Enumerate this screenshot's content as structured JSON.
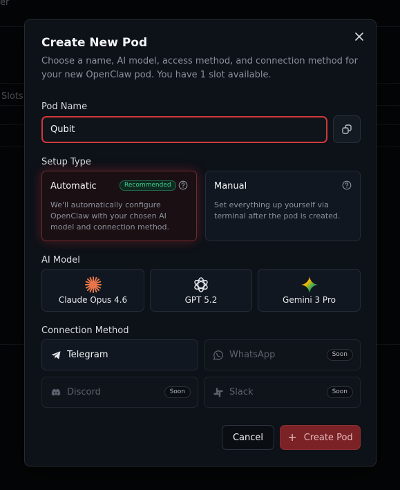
{
  "background": {
    "fragment_top": "er",
    "fragment_slots": "Slots"
  },
  "modal": {
    "title": "Create New Pod",
    "description": "Choose a name, AI model, access method, and connection method for your new OpenClaw pod. You have 1 slot available.",
    "close_icon": "close-icon"
  },
  "pod_name": {
    "label": "Pod Name",
    "value": "Qubit",
    "link_icon": "link-icon"
  },
  "setup_type": {
    "label": "Setup Type",
    "options": [
      {
        "title": "Automatic",
        "badge": "Recommended",
        "description": "We'll automatically configure OpenClaw with your chosen AI model and connection method.",
        "selected": true
      },
      {
        "title": "Manual",
        "description": "Set everything up yourself via terminal after the pod is created.",
        "selected": false
      }
    ]
  },
  "ai_model": {
    "label": "AI Model",
    "options": [
      {
        "name": "Claude Opus 4.6",
        "icon": "claude-icon"
      },
      {
        "name": "GPT 5.2",
        "icon": "openai-icon"
      },
      {
        "name": "Gemini 3 Pro",
        "icon": "gemini-icon"
      }
    ]
  },
  "connection_method": {
    "label": "Connection Method",
    "options": [
      {
        "name": "Telegram",
        "icon": "telegram-icon",
        "badge": ""
      },
      {
        "name": "WhatsApp",
        "icon": "whatsapp-icon",
        "badge": "Soon"
      },
      {
        "name": "Discord",
        "icon": "discord-icon",
        "badge": "Soon"
      },
      {
        "name": "Slack",
        "icon": "slack-icon",
        "badge": "Soon"
      }
    ]
  },
  "actions": {
    "cancel_label": "Cancel",
    "create_label": "Create Pod",
    "create_icon": "plus-icon"
  },
  "colors": {
    "accent": "#d03a3a",
    "success": "#3fcf8e",
    "background": "#0d1118"
  }
}
